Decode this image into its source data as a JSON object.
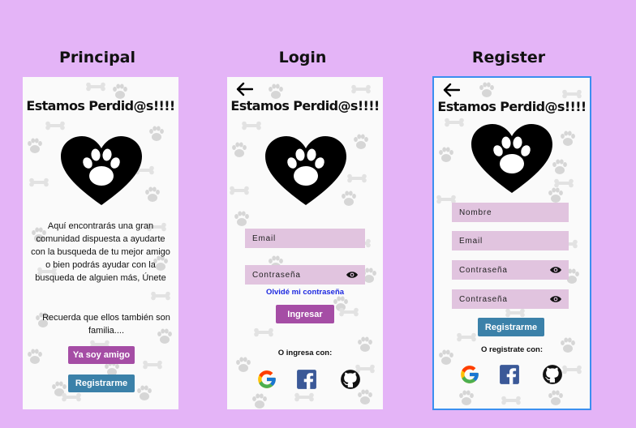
{
  "frames": {
    "principal": "Principal",
    "login": "Login",
    "register": "Register"
  },
  "app_title": "Estamos Perdid@s!!!!",
  "principal": {
    "description": "Aquí encontrarás una gran comunidad dispuesta a ayudarte con la busqueda de tu mejor amigo o bien podrás ayudar con la busqueda de alguien más, Únete",
    "reminder": "Recuerda que ellos también son familia....",
    "friend_button": "Ya soy amigo",
    "register_button": "Registrarme"
  },
  "login": {
    "email_placeholder": "Email",
    "password_placeholder": "Contraseña",
    "forgot_link": "Olvidé mi contraseña",
    "login_button": "Ingresar",
    "social_label": "O ingresa con:"
  },
  "register": {
    "name_placeholder": "Nombre",
    "email_placeholder": "Email",
    "password_placeholder": "Contraseña",
    "confirm_placeholder": "Contraseña",
    "register_button": "Registrarme",
    "social_label": "O registrate con:"
  },
  "icons": {
    "google": "google-icon",
    "facebook": "facebook-icon",
    "github": "github-icon",
    "eye": "eye-icon",
    "back": "back-arrow-icon",
    "logo": "heart-paw-icon"
  },
  "colors": {
    "background": "#e4b4f7",
    "field": "#e1c4df",
    "purple_button": "#a54da5",
    "blue_button": "#3b81a9",
    "link": "#1c28e0",
    "selection": "#3b8ff0"
  }
}
